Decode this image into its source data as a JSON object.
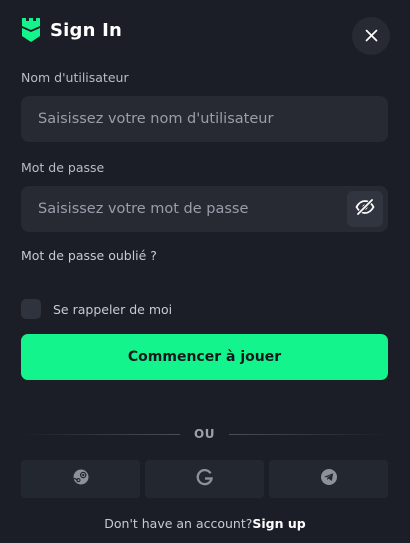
{
  "header": {
    "title": "Sign In",
    "logo_icon": "shield-logo-icon",
    "logo_color": "#13f58c",
    "close_icon": "close-icon"
  },
  "form": {
    "username": {
      "label": "Nom d'utilisateur",
      "placeholder": "Saisissez votre nom d'utilisateur",
      "value": ""
    },
    "password": {
      "label": "Mot de passe",
      "placeholder": "Saisissez votre mot de passe",
      "value": "",
      "toggle_icon": "eye-off-icon"
    },
    "forgot_password": "Mot de passe oublié ?",
    "remember_me": {
      "label": "Se rappeler de moi",
      "checked": false
    },
    "submit_label": "Commencer à jouer",
    "accent_color": "#13f58c"
  },
  "divider": {
    "text": "OU"
  },
  "social": [
    {
      "name": "steam",
      "icon": "steam-icon"
    },
    {
      "name": "google",
      "icon": "google-icon"
    },
    {
      "name": "telegram",
      "icon": "telegram-icon"
    }
  ],
  "footer": {
    "prompt": "Don't have an account?",
    "signup_label": "Sign up"
  }
}
